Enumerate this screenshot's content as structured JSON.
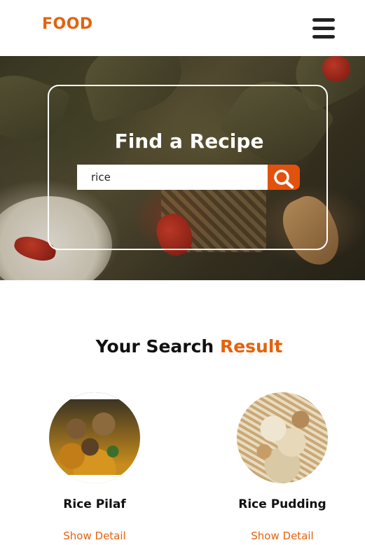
{
  "header": {
    "logo": "FOOD",
    "menu_icon": "hamburger-menu-icon"
  },
  "hero": {
    "title": "Find a Recipe",
    "search": {
      "value": "rice",
      "placeholder": "",
      "button_icon": "search-icon"
    }
  },
  "results": {
    "title_main": "Your Search",
    "title_accent": "Result",
    "accent_color": "#e2630f",
    "items": [
      {
        "name": "Rice Pilaf",
        "link": "Show Detail"
      },
      {
        "name": "Rice Pudding",
        "link": "Show Detail"
      }
    ]
  }
}
